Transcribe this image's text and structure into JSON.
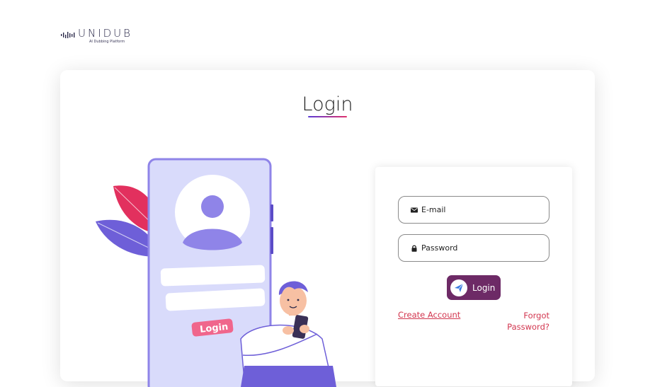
{
  "brand": {
    "name": "UNIDUB",
    "tagline": "AI Dubbing Platform"
  },
  "page": {
    "title": "Login"
  },
  "illustration": {
    "button_label": "Login"
  },
  "form": {
    "email_placeholder": "E-mail",
    "password_placeholder": "Password",
    "submit_label": "Login",
    "create_account_label": "Create Account",
    "forgot_password_label": "Forgot Password?"
  },
  "colors": {
    "accent": "#6d2a66",
    "link": "#d2364f",
    "illustration_purple": "#8f84e8",
    "illustration_pink": "#e2305e"
  }
}
